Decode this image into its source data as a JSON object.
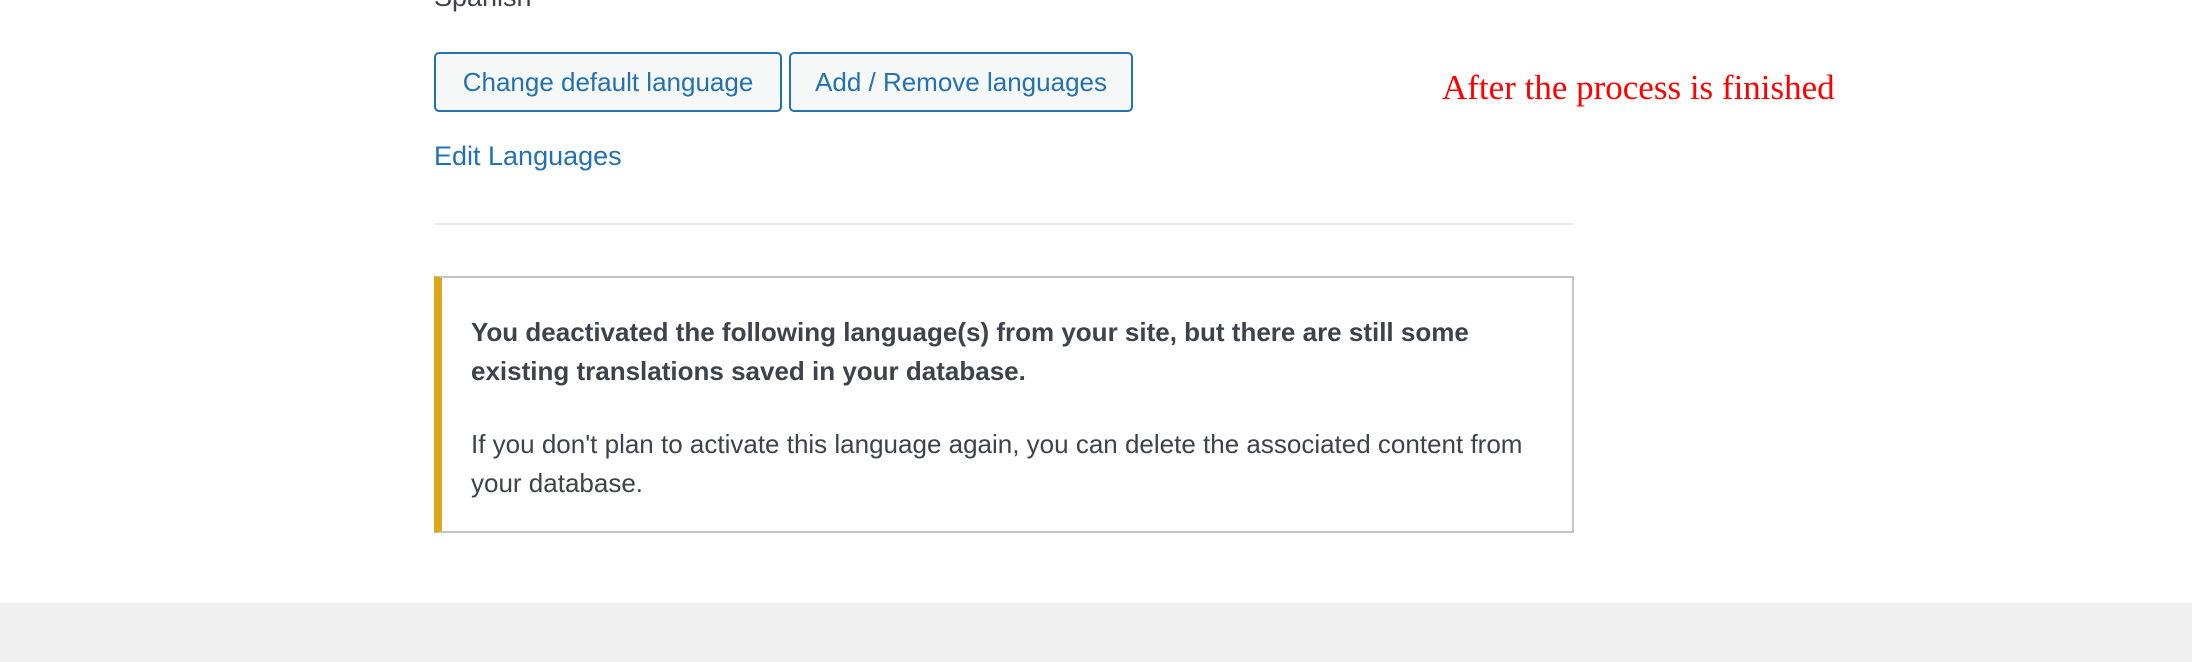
{
  "languages": {
    "partial_language_label": "Spanish"
  },
  "actions": {
    "change_default_label": "Change default language",
    "add_remove_label": "Add / Remove languages",
    "edit_languages_label": "Edit Languages"
  },
  "annotation": {
    "text": "After the process is finished",
    "color": "#ff0000"
  },
  "notice": {
    "title": "You deactivated the following language(s) from your site, but there are still some existing translations saved in your database.",
    "body": "If you don't plan to activate this language again, you can delete the associated content from your database.",
    "accent_color": "#dba617"
  },
  "colors": {
    "link": "#2271b1",
    "footer_background": "#f0f0f1"
  }
}
